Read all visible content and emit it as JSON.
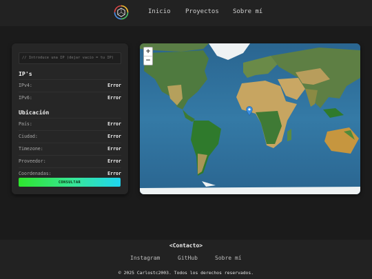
{
  "nav": {
    "home": "Inicio",
    "projects": "Proyectos",
    "about": "Sobre mí"
  },
  "panel": {
    "input_placeholder": "// Introduce una IP (dejar vacío = tu IP)",
    "ips_title": "IP's",
    "ipv4_label": "IPv4:",
    "ipv4_value": "Error",
    "ipv6_label": "IPv6:",
    "ipv6_value": "Error",
    "location_title": "Ubicación",
    "country_label": "País:",
    "country_value": "Error",
    "city_label": "Ciudad:",
    "city_value": "Error",
    "timezone_label": "Timezone:",
    "timezone_value": "Error",
    "provider_label": "Proveedor:",
    "provider_value": "Error",
    "coords_label": "Coordenadas:",
    "coords_value": "Error",
    "button_label": "CONSULTAR"
  },
  "map": {
    "zoom_in": "+",
    "zoom_out": "−",
    "marker_lat": 0,
    "marker_lon": 0
  },
  "footer": {
    "title": "<Contacto>",
    "instagram": "Instagram",
    "github": "GitHub",
    "about": "Sobre mí",
    "copyright": "© 2025 Carlostc2003. Todos los derechos reservados."
  },
  "colors": {
    "background": "#1b1b1b",
    "bar": "#222222",
    "panel": "#262626",
    "button_start": "#2ee62e",
    "button_end": "#1fd6f0",
    "ocean": "#2f6f9b",
    "marker": "#3b8fe0"
  },
  "icons": {
    "logo": "hexagon-logo-icon",
    "marker": "map-marker-icon"
  }
}
